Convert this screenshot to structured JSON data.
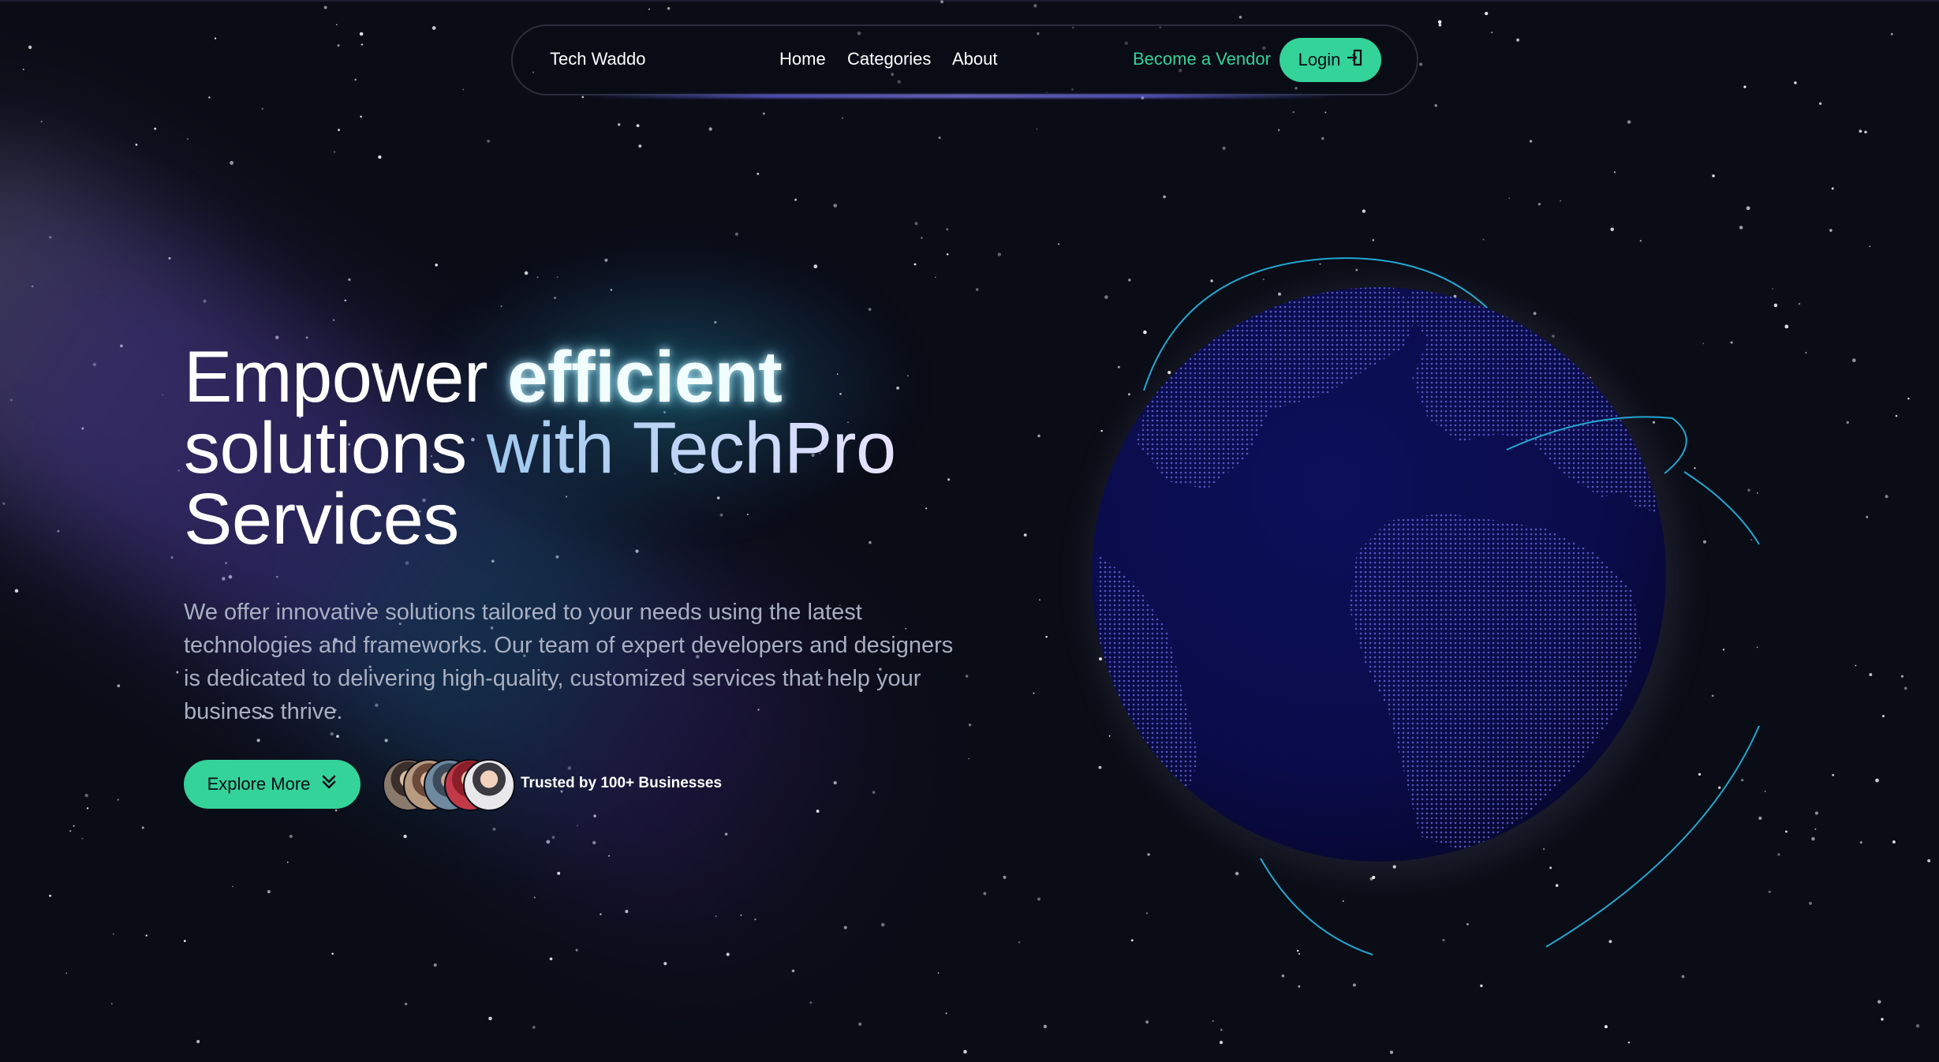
{
  "nav": {
    "brand": "Tech Waddo",
    "links": [
      "Home",
      "Categories",
      "About"
    ],
    "vendor": "Become a Vendor",
    "login": "Login"
  },
  "hero": {
    "title_part1": "Empower",
    "title_highlight": "efficient",
    "title_part2": "solutions",
    "title_gradient": "with TechPro",
    "title_part3": "Services",
    "description": "We offer innovative solutions tailored to your needs using the latest technologies and frameworks. Our team of expert developers and designers is dedicated to delivering high-quality, customized services that help your business thrive.",
    "cta": "Explore More",
    "trusted": "Trusted by 100+ Businesses"
  },
  "icons": {
    "login": "door-enter-icon",
    "explore": "double-chevron-down-icon",
    "globe": "world-globe"
  },
  "colors": {
    "accent": "#34d399",
    "background": "#0a0c16",
    "globe": "#0b0c4a",
    "orbit": "#22a7d1"
  }
}
